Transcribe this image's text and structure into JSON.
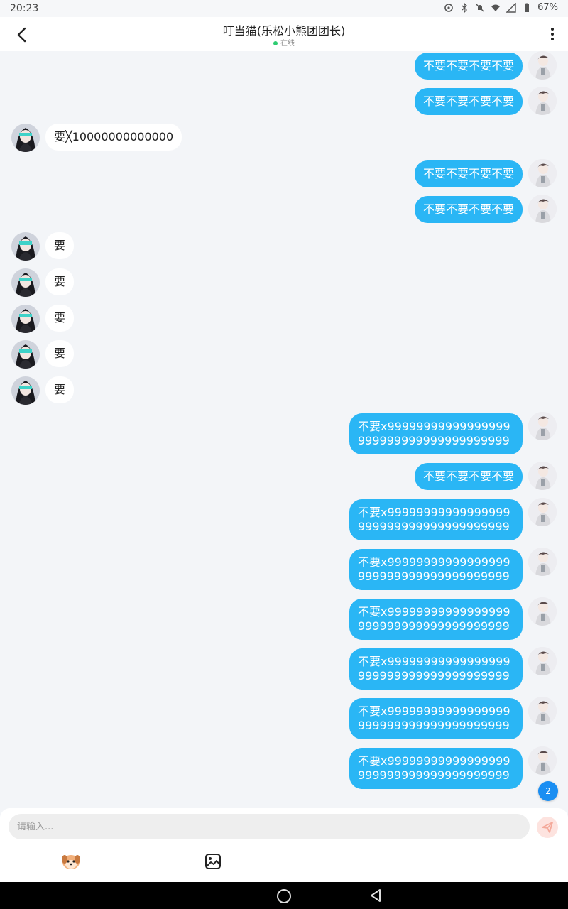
{
  "status_bar": {
    "time": "20:23",
    "battery": "67%"
  },
  "header": {
    "title": "叮当猫(乐松小熊团团长)",
    "status": "在线"
  },
  "messages": [
    {
      "side": "out",
      "text": "不要不要不要不要"
    },
    {
      "side": "out",
      "text": "不要不要不要不要"
    },
    {
      "side": "in",
      "text": "要╳10000000000000"
    },
    {
      "side": "out",
      "text": "不要不要不要不要"
    },
    {
      "side": "out",
      "text": "不要不要不要不要"
    },
    {
      "side": "in",
      "text": "要"
    },
    {
      "side": "in",
      "text": "要"
    },
    {
      "side": "in",
      "text": "要"
    },
    {
      "side": "in",
      "text": "要"
    },
    {
      "side": "in",
      "text": "要"
    },
    {
      "side": "out",
      "text": "不要x99999999999999999999999999999999999999"
    },
    {
      "side": "out",
      "text": "不要不要不要不要"
    },
    {
      "side": "out",
      "text": "不要x99999999999999999999999999999999999999"
    },
    {
      "side": "out",
      "text": "不要x99999999999999999999999999999999999999"
    },
    {
      "side": "out",
      "text": "不要x99999999999999999999999999999999999999"
    },
    {
      "side": "out",
      "text": "不要x99999999999999999999999999999999999999"
    },
    {
      "side": "out",
      "text": "不要x99999999999999999999999999999999999999"
    },
    {
      "side": "out",
      "text": "不要x99999999999999999999999999999999999999"
    }
  ],
  "unread_badge": "2",
  "input": {
    "placeholder": "请输入..."
  },
  "tools": [
    "sticker-icon",
    "image-icon"
  ],
  "colors": {
    "outgoing_bubble": "#2ab6f5",
    "incoming_bubble": "#ffffff",
    "background": "#f3f5f8",
    "badge": "#1a8ef2"
  }
}
